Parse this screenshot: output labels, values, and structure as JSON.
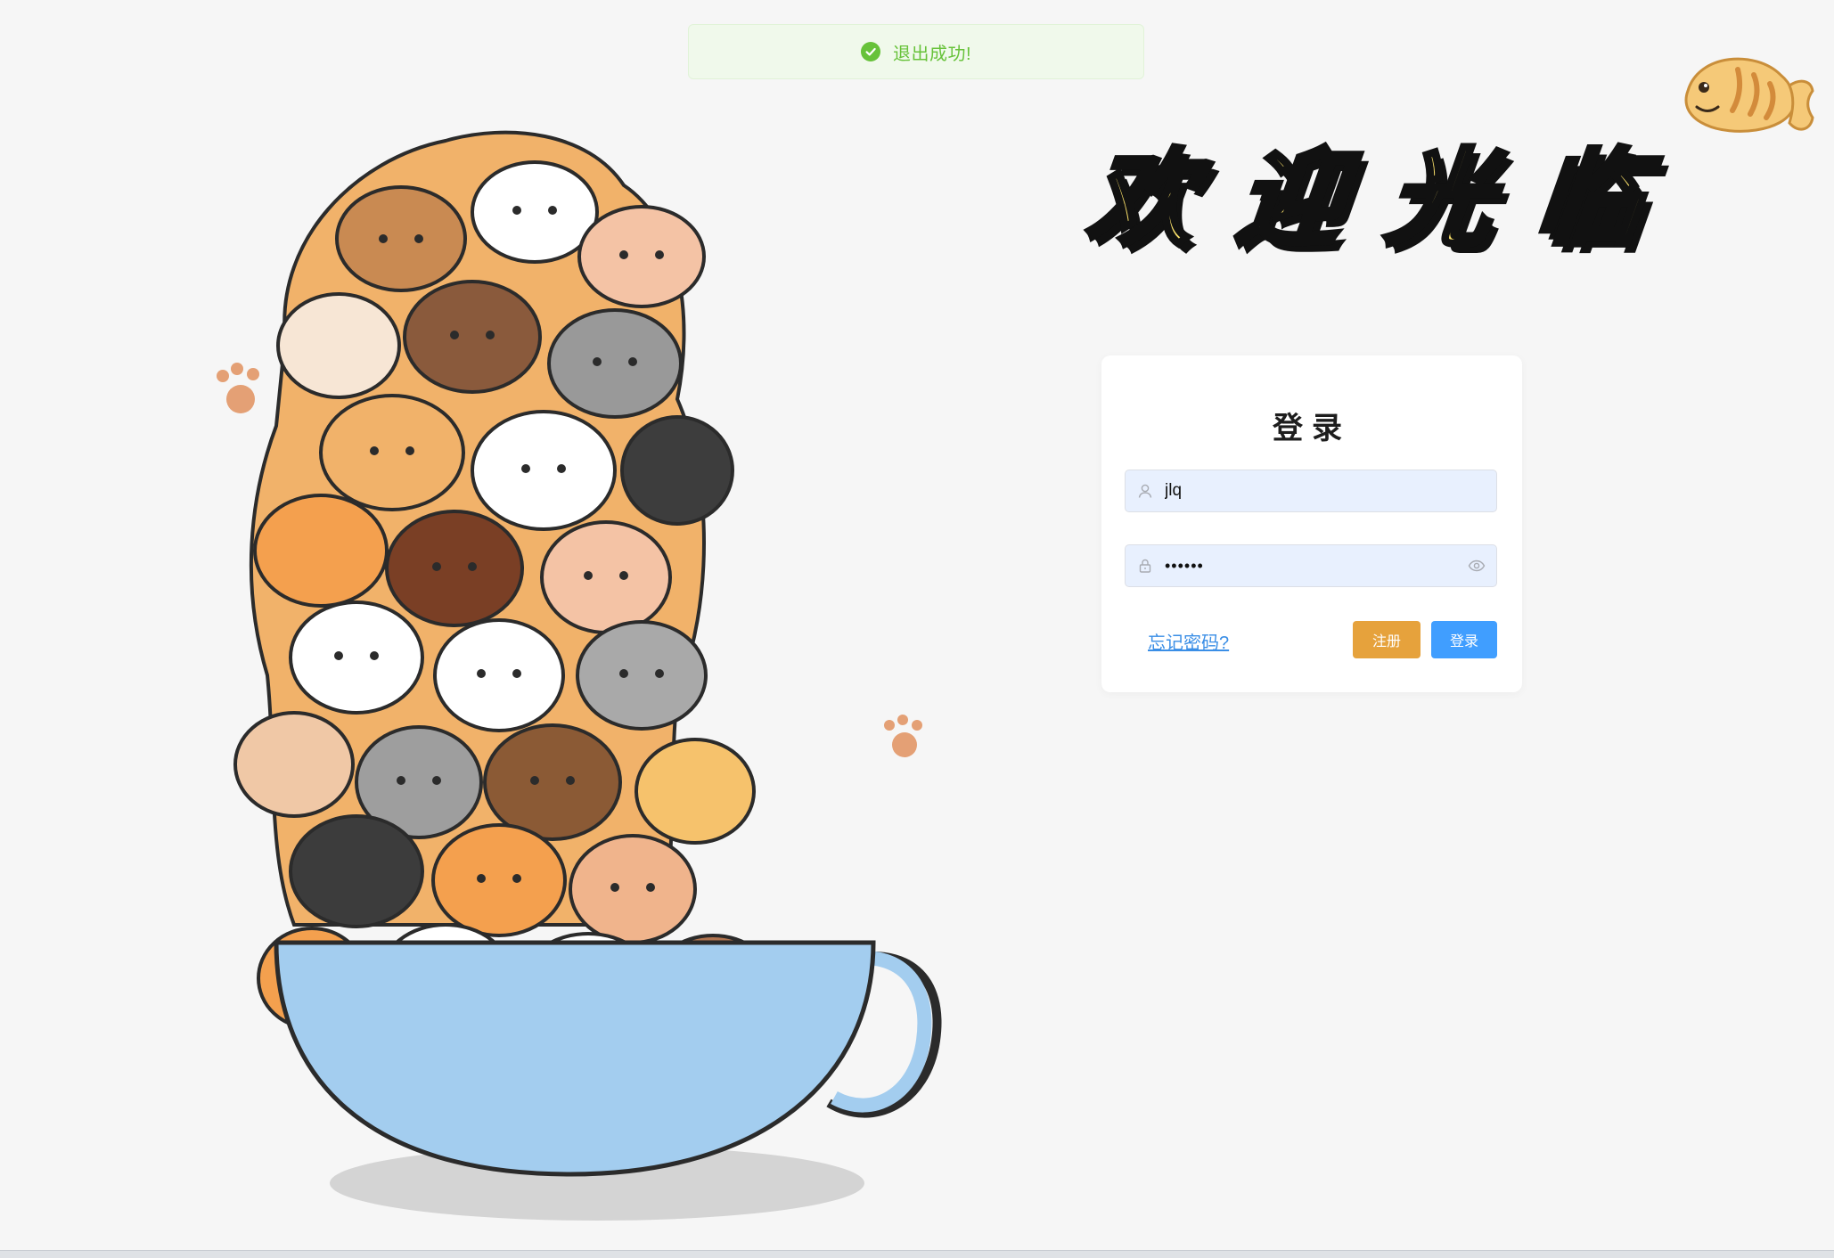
{
  "toast": {
    "message": "退出成功!",
    "icon": "check-circle-icon",
    "color": "#67c23a"
  },
  "welcome": {
    "chars": [
      "欢",
      "迎",
      "光",
      "临"
    ]
  },
  "login": {
    "title": "登录",
    "username": {
      "value": "jlq",
      "icon": "user-icon"
    },
    "password": {
      "value": "••••••",
      "icon": "lock-icon",
      "toggle_icon": "eye-icon"
    },
    "forgot_label": "忘记密码?",
    "register_label": "注册",
    "login_label": "登录"
  },
  "colors": {
    "background": "#f6f6f6",
    "success": "#67c23a",
    "warning": "#e6a23c",
    "primary": "#409eff",
    "input_fill": "#e8f0fe",
    "welcome_yellow": "#fde36b"
  }
}
